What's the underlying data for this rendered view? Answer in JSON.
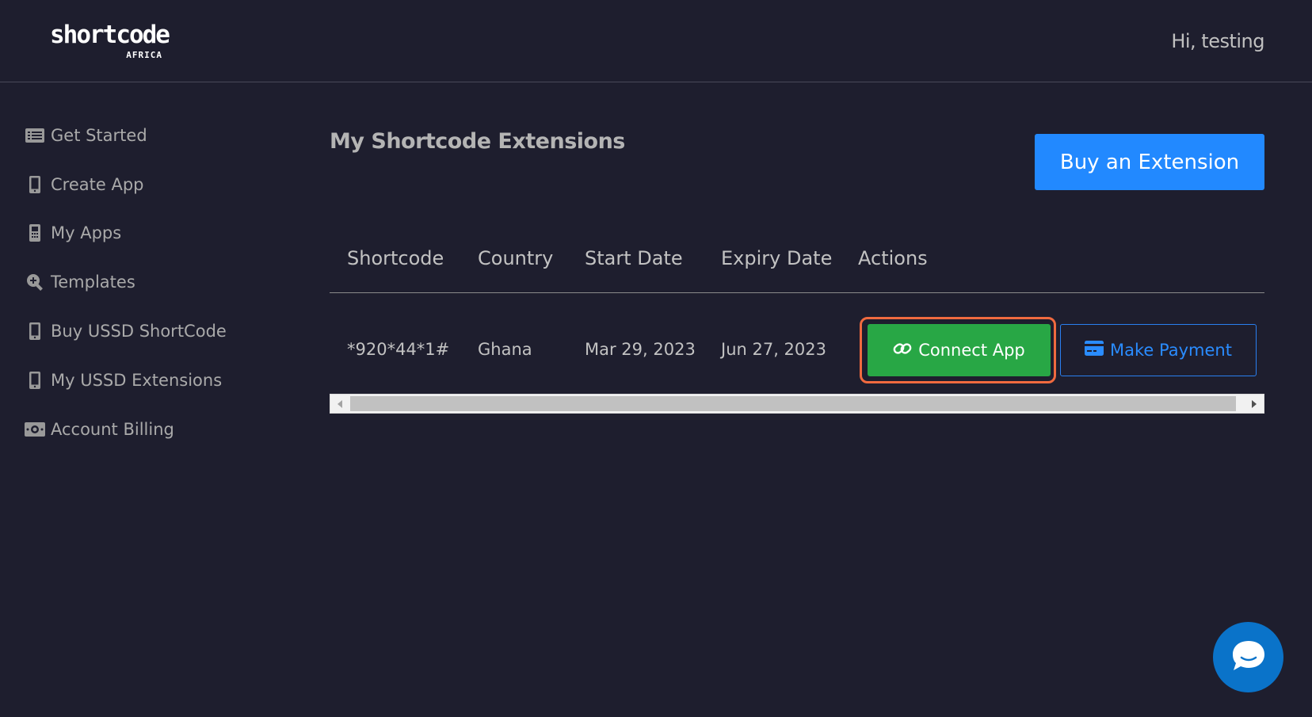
{
  "header": {
    "logo_word": "shortcode",
    "logo_sub": "AFRICA",
    "greeting": "Hi, testing"
  },
  "sidebar": {
    "items": [
      {
        "label": "Get Started",
        "icon": "list-icon"
      },
      {
        "label": "Create App",
        "icon": "mobile-icon"
      },
      {
        "label": "My Apps",
        "icon": "mobile-alt-icon"
      },
      {
        "label": "Templates",
        "icon": "search-plus-icon"
      },
      {
        "label": "Buy USSD ShortCode",
        "icon": "mobile-icon"
      },
      {
        "label": "My USSD Extensions",
        "icon": "mobile-icon"
      },
      {
        "label": "Account Billing",
        "icon": "money-bill-icon"
      }
    ]
  },
  "main": {
    "title": "My Shortcode Extensions",
    "buy_button_label": "Buy an Extension",
    "table": {
      "columns": [
        "Shortcode",
        "Country",
        "Start Date",
        "Expiry Date",
        "Actions"
      ],
      "rows": [
        {
          "shortcode": "*920*44*1#",
          "country": "Ghana",
          "start_date": "Mar 29, 2023",
          "expiry_date": "Jun 27, 2023",
          "connect_label": "Connect App",
          "payment_label": "Make Payment"
        }
      ]
    }
  },
  "colors": {
    "background": "#1e1e2e",
    "primary": "#2289ff",
    "success": "#28a745",
    "highlight": "#f06a3f",
    "chat": "#0a73c9"
  }
}
